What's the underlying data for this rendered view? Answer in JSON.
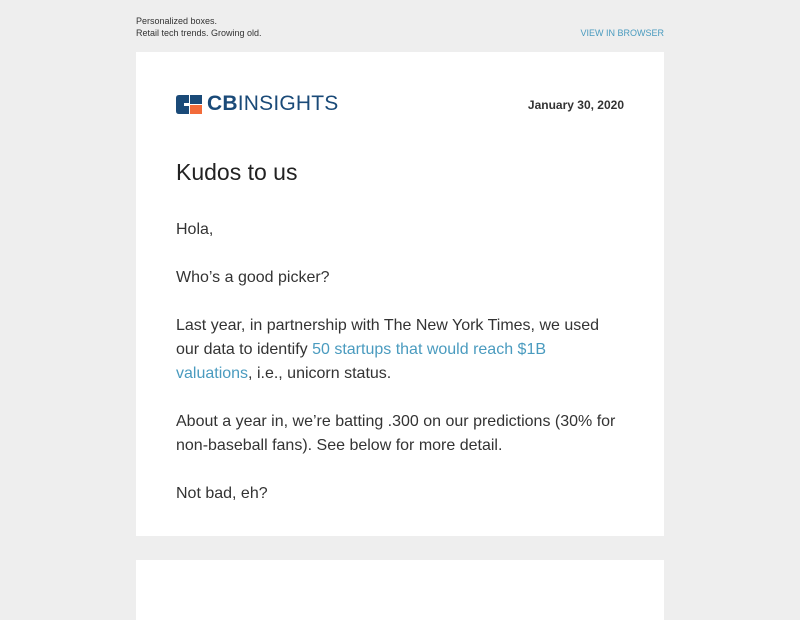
{
  "preheader": {
    "line1": "Personalized boxes.",
    "line2": "Retail tech trends. Growing old.",
    "view_in_browser": "VIEW IN BROWSER"
  },
  "header": {
    "logo_cb": "CB",
    "logo_insights": "INSIGHTS",
    "logo_colors": {
      "navy": "#1a4a78",
      "orange": "#f26b3a"
    },
    "date": "January 30, 2020"
  },
  "article": {
    "title": "Kudos to us",
    "greeting": "Hola,",
    "p1": "Who’s a good picker?",
    "p2_before": "Last year, in partnership with The New York Times, we used our data to identify ",
    "p2_link": "50 startups that would reach $1B valuations",
    "p2_after": ", i.e., unicorn status.",
    "p3": "About a year in, we’re batting .300 on our predictions (30% for non-baseball fans). See below for more detail.",
    "p4": "Not bad, eh?"
  },
  "colors": {
    "background": "#eeeeee",
    "card": "#ffffff",
    "link": "#4a9bbf",
    "text": "#333333"
  }
}
